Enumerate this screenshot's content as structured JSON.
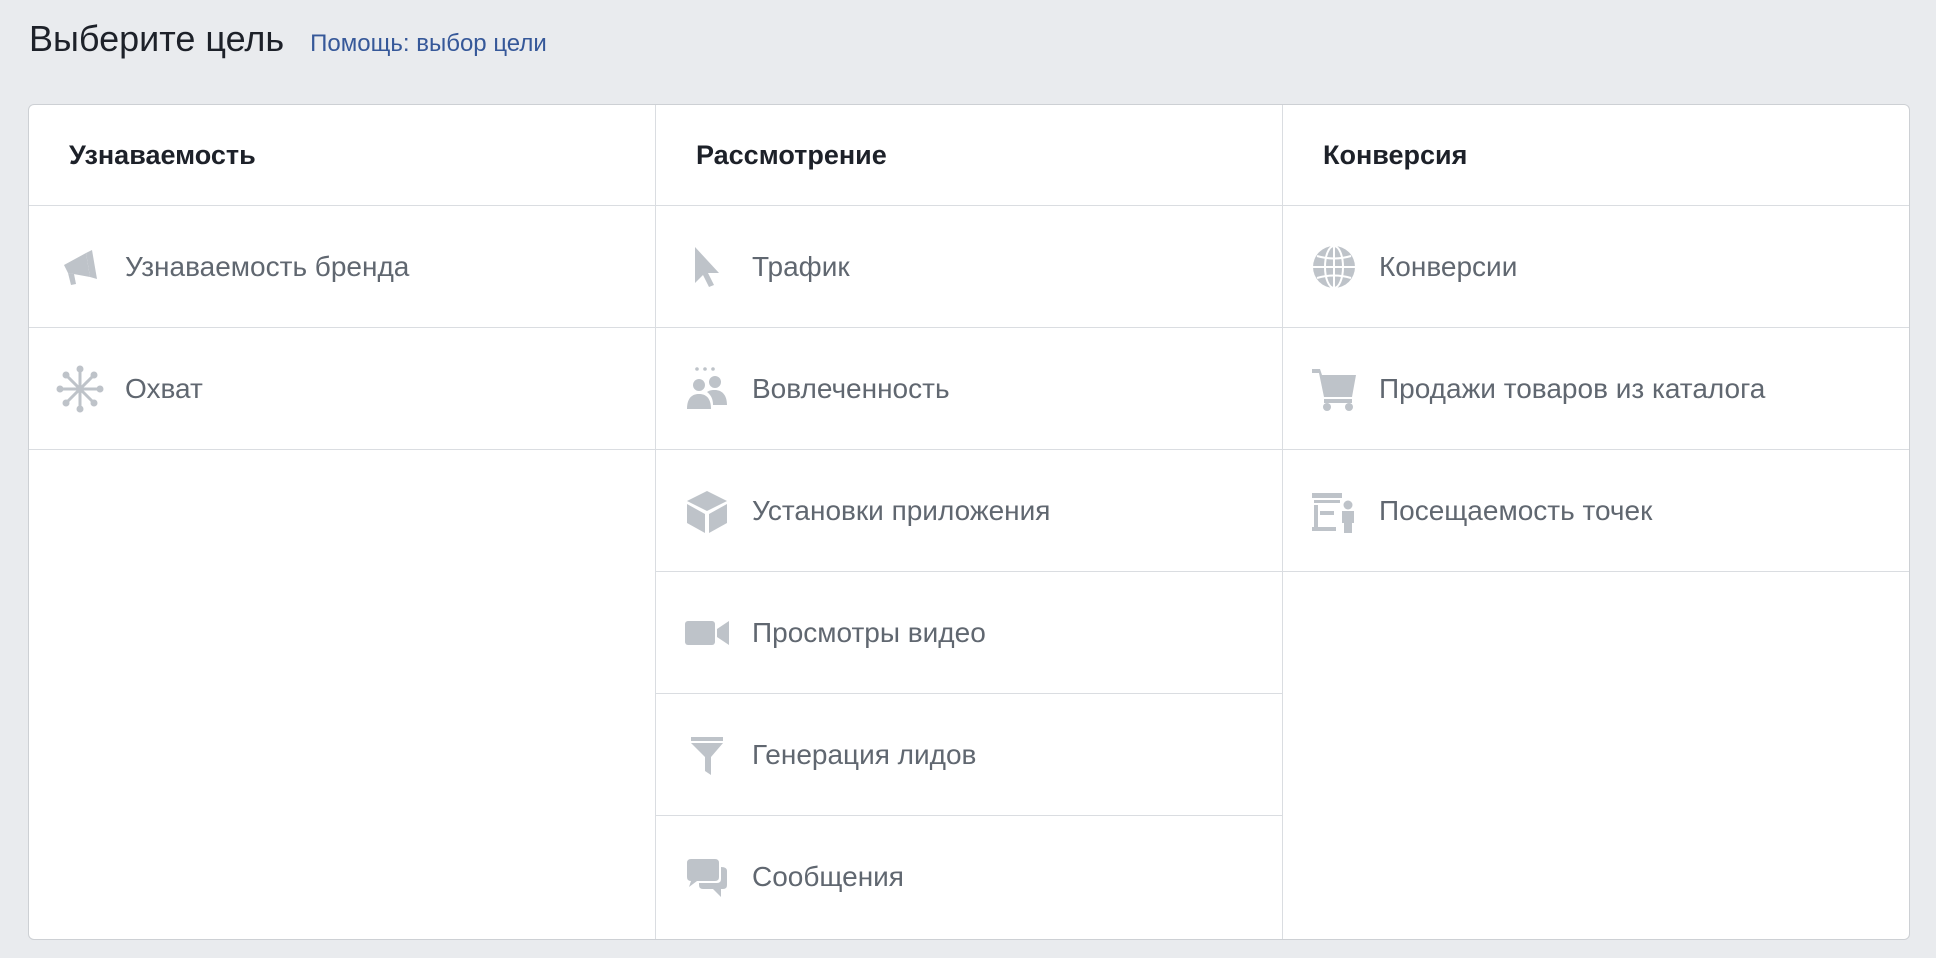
{
  "header": {
    "title": "Выберите цель",
    "help_link": "Помощь: выбор цели"
  },
  "columns": [
    {
      "title": "Узнаваемость",
      "items": [
        {
          "label": "Узнаваемость бренда",
          "icon": "megaphone-icon"
        },
        {
          "label": "Охват",
          "icon": "reach-icon"
        }
      ]
    },
    {
      "title": "Рассмотрение",
      "items": [
        {
          "label": "Трафик",
          "icon": "cursor-icon"
        },
        {
          "label": "Вовлеченность",
          "icon": "people-icon"
        },
        {
          "label": "Установки приложения",
          "icon": "box-icon"
        },
        {
          "label": "Просмотры видео",
          "icon": "video-camera-icon"
        },
        {
          "label": "Генерация лидов",
          "icon": "funnel-icon"
        },
        {
          "label": "Сообщения",
          "icon": "chat-bubbles-icon"
        }
      ]
    },
    {
      "title": "Конверсия",
      "items": [
        {
          "label": "Конверсии",
          "icon": "globe-icon"
        },
        {
          "label": "Продажи товаров из каталога",
          "icon": "shopping-cart-icon"
        },
        {
          "label": "Посещаемость точек",
          "icon": "store-visits-icon"
        }
      ]
    }
  ],
  "colors": {
    "background": "#e9ebee",
    "link": "#365899",
    "icon": "#bec3c9",
    "label": "#606770"
  }
}
